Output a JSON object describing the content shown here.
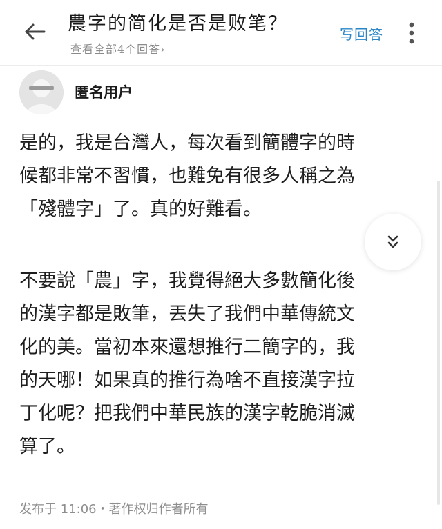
{
  "header": {
    "question_title": "農字的简化是否是败笔？",
    "answers_link": "查看全部4个回答›",
    "write_answer_label": "写回答"
  },
  "answer": {
    "author": "匿名用户",
    "paragraphs": [
      {
        "lines": [
          "是的，我是台灣人，每次看到簡體字的時",
          "候都非常不習慣，也難免有很多人稱之為",
          "「殘體字」了。真的好難看。"
        ]
      },
      {
        "lines": [
          "不要說「農」字，我覺得絕大多數簡化後",
          "的漢字都是敗筆，丟失了我們中華傳統文",
          "化的美。當初本來還想推行二簡字的，我",
          "的天哪！如果真的推行為啥不直接漢字拉",
          "丁化呢？把我們中華民族的漢字乾脆消滅",
          "算了。"
        ]
      }
    ],
    "footer": "发布于 11:06・著作权归作者所有"
  },
  "icons": {
    "back": "arrow-left-icon",
    "more": "more-vertical-icon",
    "expand": "chevron-double-down-icon",
    "avatar": "anonymous-avatar"
  },
  "colors": {
    "accent": "#2a86c8",
    "text": "#1e1e1e",
    "muted": "#8e8e8e"
  }
}
